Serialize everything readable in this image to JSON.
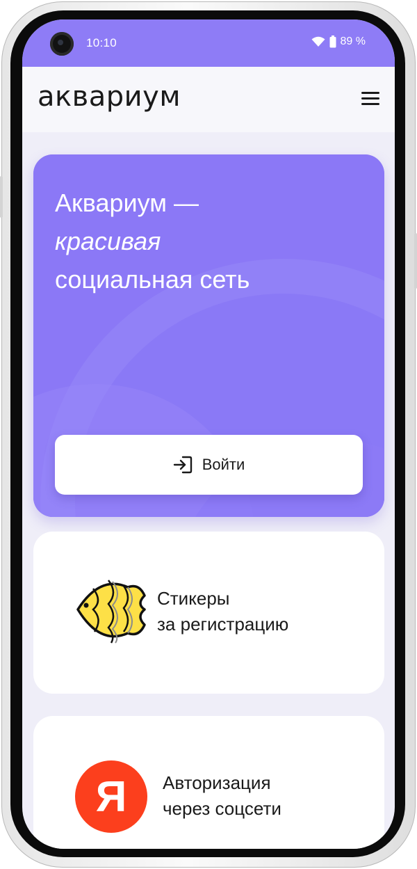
{
  "status": {
    "time": "10:10",
    "battery": "89 %"
  },
  "header": {
    "logo": "аквариум",
    "menu_icon": "hamburger-icon"
  },
  "hero": {
    "line1": "Аквариум —",
    "line2": "красивая",
    "line3": "социальная сеть",
    "login_label": "Войти",
    "login_icon": "sign-in-icon",
    "bg_color": "#8b78f6"
  },
  "cards": [
    {
      "line1": "Стикеры",
      "line2": "за регистрацию",
      "icon": "fish-sticker-icon"
    },
    {
      "line1": "Авторизация",
      "line2": "через соцсети",
      "icon_letter": "Я",
      "icon": "yandex-logo-icon"
    }
  ]
}
